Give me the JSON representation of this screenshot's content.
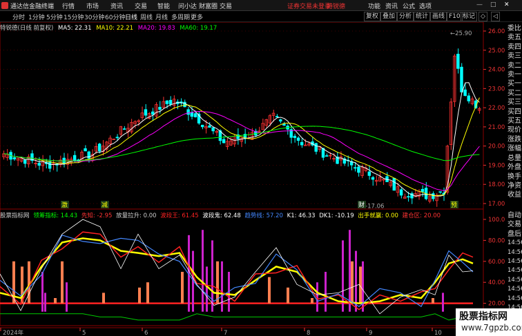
{
  "titlebar": {
    "app_name": "通达信金融终端",
    "menus": [
      "行情",
      "市场",
      "资讯",
      "交易",
      "智能",
      "问小达",
      "财富圈",
      "交易"
    ],
    "login_status": "证券交易未登录",
    "stock_name": "特锐德",
    "right_menus": [
      "功能",
      "资讯",
      "公式",
      "选项"
    ]
  },
  "toolbar": {
    "periods": [
      "分时",
      "1分钟",
      "5分钟",
      "15分钟",
      "30分钟",
      "60分钟",
      "日线",
      "周线",
      "月线",
      "多周期",
      "更多"
    ],
    "active_period": "日线",
    "right_buttons": [
      "复权",
      "叠加",
      "分析",
      "统计",
      "画线",
      "F10",
      "标记"
    ]
  },
  "infobar": {
    "title": "特锐德(日线 前复权)",
    "ma5": "MA5: 22.31",
    "ma10": "MA10: 22.21",
    "ma20": "MA20: 19.83",
    "ma60": "MA60: 19.17",
    "colors": {
      "title": "#cccccc",
      "ma5": "#ffffff",
      "ma10": "#ffff00",
      "ma20": "#ff00ff",
      "ma60": "#00ff00"
    }
  },
  "price_axis": {
    "ticks": [
      "26.00",
      "25.00",
      "24.00",
      "23.00",
      "22.00",
      "21.00",
      "20.00",
      "19.00",
      "18.00",
      "17.00"
    ],
    "high_label": "25.90",
    "low_label": "17.06"
  },
  "volume_axis": {
    "ticks": [
      "100.0",
      "80.00",
      "60.00",
      "40.00",
      "20.00",
      "0.00"
    ]
  },
  "indicator_bar": {
    "name": "股票指标网",
    "items": [
      {
        "label": "领筹指标: 14.43",
        "color": "#00ff00"
      },
      {
        "label": "先知: -2.95",
        "color": "#ff3333"
      },
      {
        "label": "放量拉升: 0.00",
        "color": "#cccccc"
      },
      {
        "label": "波段王: 61.45",
        "color": "#ff2222"
      },
      {
        "label": "波段鬼: 62.48",
        "color": "#ffffff"
      },
      {
        "label": "趋势线: 57.20",
        "color": "#4488ff"
      },
      {
        "label": "K1: 46.33",
        "color": "#ffffff"
      },
      {
        "label": "DK1: -10.19",
        "color": "#ffffff"
      },
      {
        "label": "出手就赢: 0.00",
        "color": "#ffff00"
      },
      {
        "label": "建仓区: 20.00",
        "color": "#ff3333"
      }
    ]
  },
  "sidebar": [
    "委比",
    "卖五",
    "卖四",
    "卖三",
    "卖二",
    "卖一",
    "买一",
    "买二",
    "买三",
    "买四",
    "买五",
    "现价",
    "涨跌",
    "涨幅",
    "总量",
    "外盘",
    "换手",
    "净资",
    "收益"
  ],
  "sidebar2": [
    "自动",
    "交易",
    "盘后",
    "14:56",
    "14:56",
    "14:56",
    "14:56",
    "14:56",
    "14:56",
    "14:56",
    "14:56"
  ],
  "markers": [
    "激",
    "减",
    "财",
    "预"
  ],
  "x_axis": [
    "2024年",
    "5",
    "6",
    "7",
    "8",
    "9",
    "10"
  ],
  "watermark": {
    "line1": "股票指标网",
    "line2": "www.7gpzb.com"
  },
  "colors": {
    "up": "#ff3333",
    "down": "#00ffff",
    "ma5": "#ffffff",
    "ma10": "#ffff00",
    "ma20": "#ff00ff",
    "ma60": "#00ff00"
  }
}
